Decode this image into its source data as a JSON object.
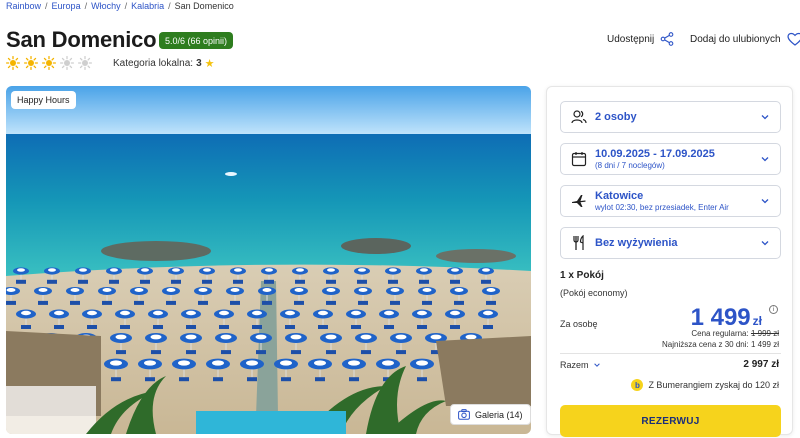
{
  "breadcrumb": {
    "items": [
      "Rainbow",
      "Europa",
      "Włochy",
      "Kalabria"
    ],
    "separator": "/",
    "current": "San Domenico"
  },
  "hotel": {
    "name": "San Domenico",
    "rating_badge": "5.0/6 (66 opinii)",
    "suns_total": 5,
    "suns_filled": 3,
    "category_label": "Kategoria lokalna:",
    "category_value": "3"
  },
  "actions": {
    "share_label": "Udostępnij",
    "favorite_label": "Dodaj do ulubionych"
  },
  "photo": {
    "badge": "Happy Hours",
    "gallery_label": "Galeria (14)"
  },
  "booking": {
    "persons": "2 osoby",
    "dates": "10.09.2025 - 17.09.2025",
    "dates_sub": "(8 dni / 7 noclegów)",
    "departure": "Katowice",
    "departure_sub": "wylot 02:30, bez przesiadek, Enter Air",
    "board": "Bez wyżywienia",
    "room": "1 x Pokój",
    "room_type": "(Pokój economy)",
    "per_person_label": "Za osobę",
    "price": "1 499",
    "currency": "zł",
    "info_symbol": "i",
    "regular_label": "Cena regularna:",
    "regular_price": "1 999 zł",
    "lowest_30": "Najniższa cena z 30 dni: 1 499 zł",
    "total_label": "Razem",
    "total_value": "2 997 zł",
    "bumerang_symbol": "b",
    "bumerang": "Z Bumerangiem zyskaj do 120 zł",
    "reserve_label": "REZERWUJ"
  },
  "colors": {
    "accent_blue": "#2d54c7",
    "rating_green": "#2e7d1f",
    "reserve_yellow": "#f6d31c",
    "sun_active": "#f4b400",
    "sun_inactive": "#cfcfcf"
  },
  "icons": [
    "sun-icon",
    "star-icon",
    "share-icon",
    "heart-icon",
    "camera-icon",
    "persons-icon",
    "calendar-icon",
    "plane-icon",
    "cutlery-icon",
    "chevron-down-icon",
    "info-icon",
    "bumerang-icon"
  ]
}
